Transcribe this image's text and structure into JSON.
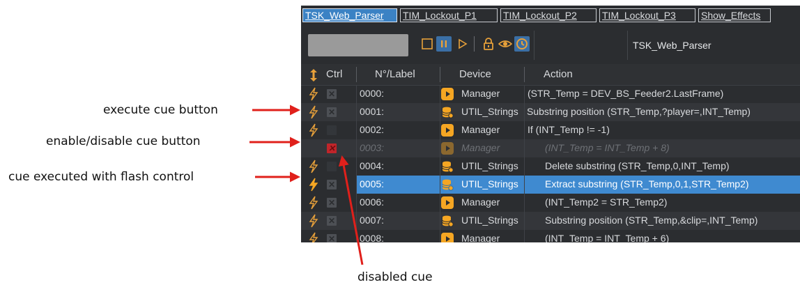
{
  "annotations": {
    "execute_cue": "execute cue button",
    "enable_disable": "enable/disable cue button",
    "flash_control": "cue executed with flash control",
    "disabled_cue": "disabled cue"
  },
  "tabs": [
    "TSK_Web_Parser",
    "TIM_Lockout_P1",
    "TIM_Lockout_P2",
    "TIM_Lockout_P3",
    "Show_Effects"
  ],
  "toolbar": {
    "sequence_name": "TSK_Web_Parser"
  },
  "columns": {
    "ctrl": "Ctrl",
    "label": "N°/Label",
    "device": "Device",
    "action": "Action"
  },
  "rows": [
    {
      "label": "0000:",
      "device": "Manager",
      "device_icon": "play-icon",
      "action": "(STR_Temp = DEV_BS_Feeder2.LastFrame)"
    },
    {
      "label": "0001:",
      "device": "UTIL_Strings",
      "device_icon": "database-icon",
      "action": "Substring position (STR_Temp,?player=,INT_Temp)"
    },
    {
      "label": "0002:",
      "device": "Manager",
      "device_icon": "play-icon",
      "action": "If (INT_Temp != -1)"
    },
    {
      "label": "0003:",
      "device": "Manager",
      "device_icon": "play-icon",
      "action": "(INT_Temp = INT_Temp + 8)"
    },
    {
      "label": "0004:",
      "device": "UTIL_Strings",
      "device_icon": "database-icon",
      "action": "Delete substring (STR_Temp,0,INT_Temp)"
    },
    {
      "label": "0005:",
      "device": "UTIL_Strings",
      "device_icon": "database-icon",
      "action": "Extract substring (STR_Temp,0,1,STR_Temp2)"
    },
    {
      "label": "0006:",
      "device": "Manager",
      "device_icon": "play-icon",
      "action": "(INT_Temp2 = STR_Temp2)"
    },
    {
      "label": "0007:",
      "device": "UTIL_Strings",
      "device_icon": "database-icon",
      "action": "Substring position (STR_Temp,&clip=,INT_Temp)"
    },
    {
      "label": "0008:",
      "device": "Manager",
      "device_icon": "play-icon",
      "action": "(INT_Temp = INT_Temp + 6)"
    }
  ],
  "colors": {
    "accent": "#3b82c4",
    "selected_row": "#3f8ad0",
    "bolt": "#e8a13a",
    "disabled_x": "#c0252a",
    "arrow": "#e0201b"
  }
}
